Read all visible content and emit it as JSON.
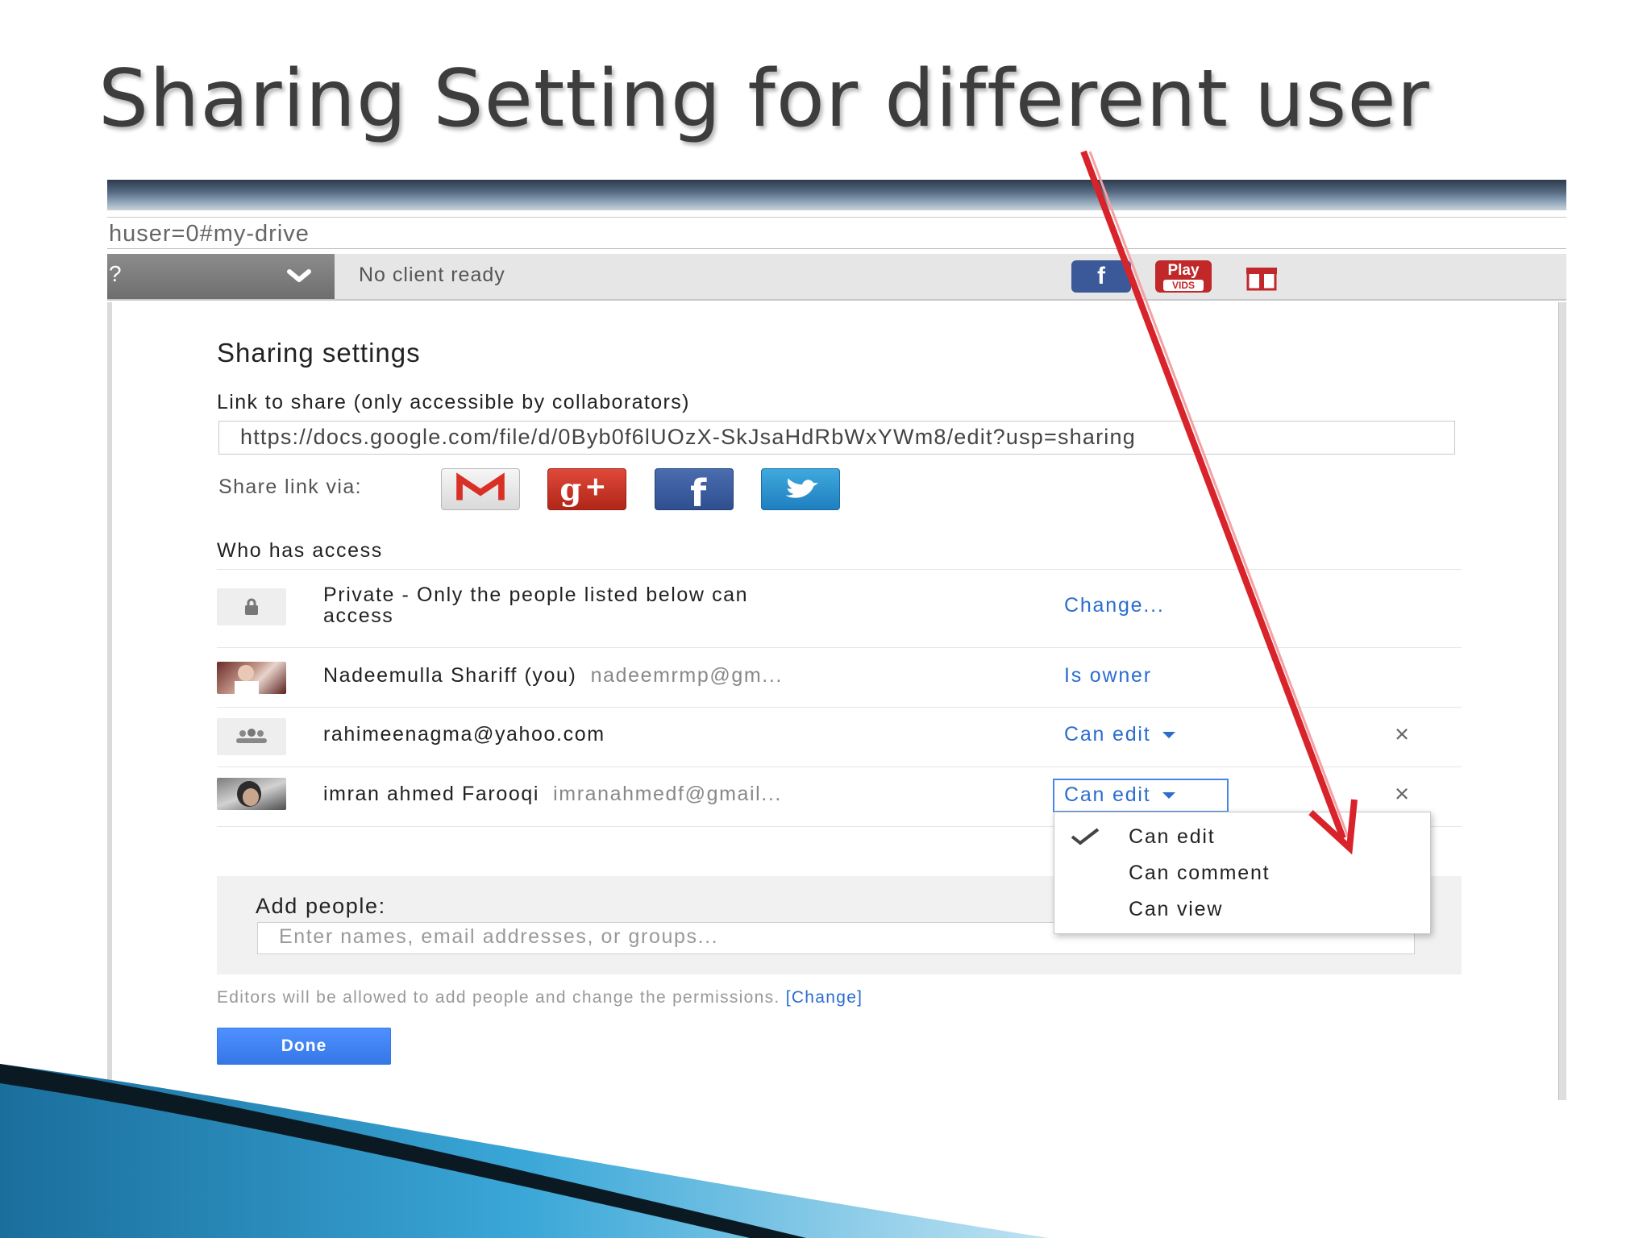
{
  "slide": {
    "title": "Sharing Setting for different user"
  },
  "browser": {
    "address_text": "huser=0#my-drive",
    "toolbar_status": "No client ready",
    "toolbar_glyph": "?",
    "ext_fb_label": "f",
    "ext_play_line1": "Play",
    "ext_play_line2": "VIDS"
  },
  "dialog": {
    "title": "Sharing settings",
    "link_label": "Link to share (only accessible by collaborators)",
    "link_value": "https://docs.google.com/file/d/0Byb0f6lUOzX-SkJsaHdRbWxYWm8/edit?usp=sharing",
    "share_via_label": "Share link via:",
    "share_icons": [
      "gmail-icon",
      "google-plus-icon",
      "facebook-icon",
      "twitter-icon"
    ],
    "access_heading": "Who has access",
    "rows": [
      {
        "name": "Private - Only the people listed below can",
        "name_line2": "access",
        "permission": "Change..."
      },
      {
        "name": "Nadeemulla Shariff (you)",
        "email": "nadeemrmp@gm...",
        "permission": "Is owner"
      },
      {
        "name": "rahimeenagma@yahoo.com",
        "permission": "Can edit"
      },
      {
        "name": "imran ahmed Farooqi",
        "email": "imranahmedf@gmail...",
        "permission": "Can edit"
      }
    ],
    "remove_symbol": "×",
    "add_people_label": "Add people:",
    "add_people_placeholder": "Enter names, email addresses, or groups...",
    "editors_note": "Editors will be allowed to add people and change the permissions.",
    "editors_note_link": "[Change]",
    "done_label": "Done",
    "permission_menu": {
      "items": [
        "Can edit",
        "Can comment",
        "Can view"
      ],
      "selected": "Can edit"
    }
  },
  "colors": {
    "link_blue": "#2b6dcf",
    "done_blue": "#4d90fe",
    "arrow_red": "#d8232a",
    "wave_dark": "#0b1a22",
    "wave_blue": "#2a8fc0"
  }
}
